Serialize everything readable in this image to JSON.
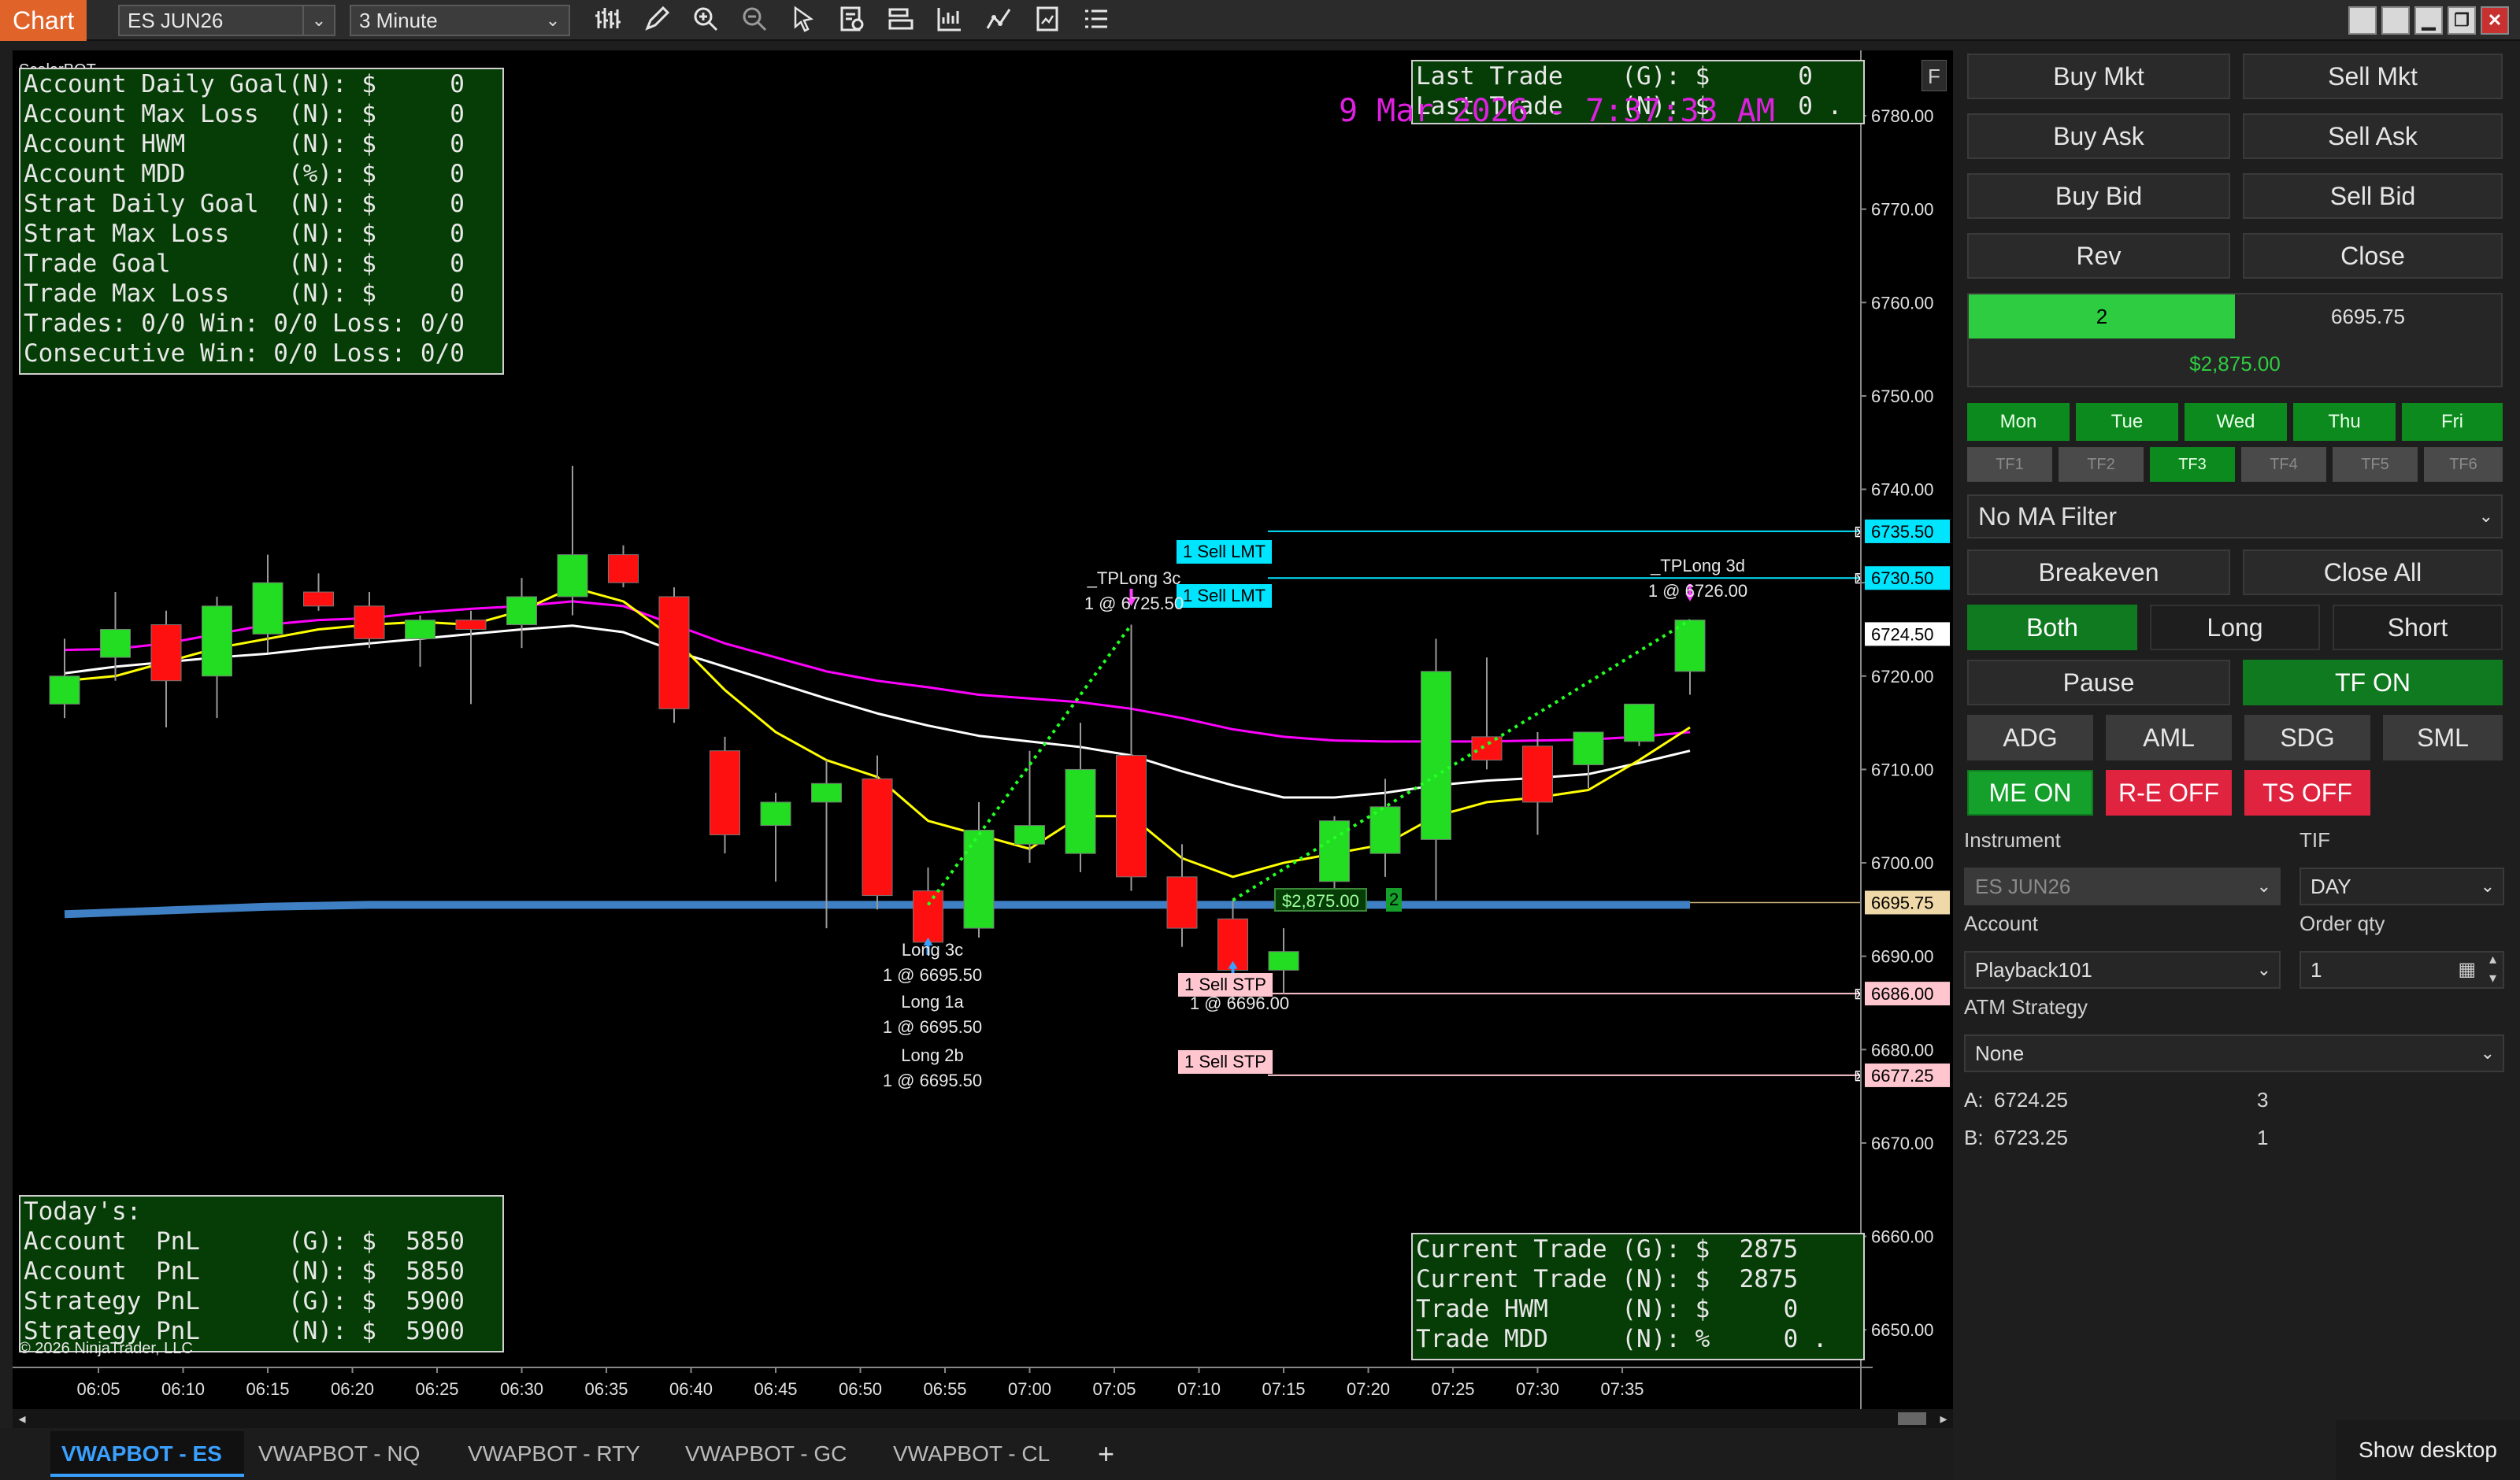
{
  "toolbar": {
    "title": "Chart",
    "instrument": "ES JUN26",
    "interval": "3 Minute",
    "icons": [
      "bar-type-icon",
      "draw-pencil-icon",
      "zoom-in-icon",
      "zoom-out-icon",
      "pointer-icon",
      "data-box-icon",
      "chart-properties-icon",
      "indicators-icon",
      "strategies-icon",
      "templates-icon",
      "list-icon"
    ]
  },
  "window_buttons": {
    "minimize": "▁",
    "restore": "❐",
    "close": "✕"
  },
  "chart": {
    "bot_name": "ScalerBOT",
    "copyright": "© 2026 NinjaTrader, LLC",
    "f_button": "F",
    "clock": "9 Mar 2026 - 7:37:33 AM",
    "top_left_panel": [
      "Account Daily Goal(N): $     0",
      "Account Max Loss  (N): $     0",
      "Account HWM       (N): $     0",
      "Account MDD       (%): $     0",
      "Strat Daily Goal  (N): $     0",
      "Strat Max Loss    (N): $     0",
      "Trade Goal        (N): $     0",
      "Trade Max Loss    (N): $     0",
      "Trades: 0/0 Win: 0/0 Loss: 0/0",
      "Consecutive Win: 0/0 Loss: 0/0"
    ],
    "top_right_panel": [
      "Last Trade    (G): $      0",
      "Last Trade    (N): $      0 ."
    ],
    "bottom_left_panel": [
      "Today's:",
      "Account  PnL      (G): $  5850",
      "Account  PnL      (N): $  5850",
      "Strategy PnL      (G): $  5900",
      "Strategy PnL      (N): $  5900"
    ],
    "bottom_right_panel": [
      "Current Trade (G): $  2875",
      "Current Trade (N): $  2875",
      "Trade HWM     (N): $     0",
      "Trade MDD     (N): %     0 ."
    ],
    "order_tags": {
      "sell_lmt_1": "1 Sell LMT",
      "sell_lmt_2": "1 Sell LMT",
      "sell_stp_1": "1 Sell STP",
      "sell_stp_2": "1 Sell STP",
      "position_pnl": "$2,875.00",
      "position_qty": "2"
    },
    "annotations": {
      "tp_long_3c": "_TPLong 3c",
      "tp_long_3c_price": "1 @ 6725.50",
      "tp_long_3d": "_TPLong 3d",
      "tp_long_3d_price": "1 @ 6726.00",
      "long_3c": "Long 3c",
      "long_3c_price": "1 @ 6695.50",
      "long_1a": "Long 1a",
      "long_1a_price": "1 @ 6695.50",
      "long_2b": "Long 2b",
      "long_2b_price": "1 @ 6695.50",
      "sell_stp_fill": "1 @ 6696.00"
    },
    "y_ticks": [
      "6780.00",
      "6770.00",
      "6760.00",
      "6750.00",
      "6740.00",
      "6730.00",
      "6720.00",
      "6710.00",
      "6700.00",
      "6690.00",
      "6680.00",
      "6670.00",
      "6660.00",
      "6650.00"
    ],
    "price_flags": [
      {
        "label": "6735.50",
        "price": 6735.5,
        "bg": "#00e5ff",
        "fg": "#000000"
      },
      {
        "label": "6730.50",
        "price": 6730.5,
        "bg": "#00e5ff",
        "fg": "#000000"
      },
      {
        "label": "6724.50",
        "price": 6724.5,
        "bg": "#ffffff",
        "fg": "#000000"
      },
      {
        "label": "6695.75",
        "price": 6695.75,
        "bg": "#f0d9a8",
        "fg": "#000000"
      },
      {
        "label": "6686.00",
        "price": 6686.0,
        "bg": "#ffc6cf",
        "fg": "#000000"
      },
      {
        "label": "6677.25",
        "price": 6677.25,
        "bg": "#ffc6cf",
        "fg": "#000000"
      }
    ],
    "x_ticks": [
      "06:05",
      "06:10",
      "06:15",
      "06:20",
      "06:25",
      "06:30",
      "06:35",
      "06:40",
      "06:45",
      "06:50",
      "06:55",
      "07:00",
      "07:05",
      "07:10",
      "07:15",
      "07:20",
      "07:25",
      "07:30",
      "07:35"
    ]
  },
  "chart_data": {
    "type": "candlestick",
    "instrument": "ES JUN26",
    "interval": "3 Minute",
    "xlabel": "",
    "ylabel": "",
    "ylim": [
      6641.5,
      6787.0
    ],
    "candles": [
      {
        "time": "06:03",
        "open": 6717.0,
        "high": 6724.0,
        "low": 6715.5,
        "close": 6720.0
      },
      {
        "time": "06:06",
        "open": 6722.0,
        "high": 6729.0,
        "low": 6719.5,
        "close": 6725.0
      },
      {
        "time": "06:09",
        "open": 6725.5,
        "high": 6727.0,
        "low": 6714.5,
        "close": 6719.5
      },
      {
        "time": "06:12",
        "open": 6720.0,
        "high": 6728.5,
        "low": 6715.5,
        "close": 6727.5
      },
      {
        "time": "06:15",
        "open": 6724.5,
        "high": 6733.0,
        "low": 6722.5,
        "close": 6730.0
      },
      {
        "time": "06:18",
        "open": 6729.0,
        "high": 6731.0,
        "low": 6727.0,
        "close": 6727.5
      },
      {
        "time": "06:21",
        "open": 6727.5,
        "high": 6729.0,
        "low": 6723.0,
        "close": 6724.0
      },
      {
        "time": "06:24",
        "open": 6724.0,
        "high": 6726.5,
        "low": 6721.0,
        "close": 6726.0
      },
      {
        "time": "06:27",
        "open": 6726.0,
        "high": 6727.0,
        "low": 6717.0,
        "close": 6725.0
      },
      {
        "time": "06:30",
        "open": 6725.5,
        "high": 6730.5,
        "low": 6723.0,
        "close": 6728.5
      },
      {
        "time": "06:33",
        "open": 6728.5,
        "high": 6742.5,
        "low": 6726.5,
        "close": 6733.0
      },
      {
        "time": "06:36",
        "open": 6733.0,
        "high": 6734.0,
        "low": 6729.5,
        "close": 6730.0
      },
      {
        "time": "06:39",
        "open": 6728.5,
        "high": 6729.5,
        "low": 6715.0,
        "close": 6716.5
      },
      {
        "time": "06:42",
        "open": 6712.0,
        "high": 6713.5,
        "low": 6701.0,
        "close": 6703.0
      },
      {
        "time": "06:45",
        "open": 6704.0,
        "high": 6707.5,
        "low": 6698.0,
        "close": 6706.5
      },
      {
        "time": "06:48",
        "open": 6706.5,
        "high": 6711.0,
        "low": 6693.0,
        "close": 6708.5
      },
      {
        "time": "06:51",
        "open": 6709.0,
        "high": 6711.5,
        "low": 6695.0,
        "close": 6696.5
      },
      {
        "time": "06:54",
        "open": 6697.0,
        "high": 6699.5,
        "low": 6691.5,
        "close": 6691.5
      },
      {
        "time": "06:57",
        "open": 6693.0,
        "high": 6706.5,
        "low": 6692.0,
        "close": 6703.5
      },
      {
        "time": "07:00",
        "open": 6702.0,
        "high": 6712.0,
        "low": 6700.0,
        "close": 6704.0
      },
      {
        "time": "07:03",
        "open": 6701.0,
        "high": 6715.0,
        "low": 6699.0,
        "close": 6710.0
      },
      {
        "time": "07:06",
        "open": 6711.5,
        "high": 6725.5,
        "low": 6697.0,
        "close": 6698.5
      },
      {
        "time": "07:09",
        "open": 6698.5,
        "high": 6702.0,
        "low": 6691.0,
        "close": 6693.0
      },
      {
        "time": "07:12",
        "open": 6694.0,
        "high": 6696.0,
        "low": 6685.0,
        "close": 6688.5
      },
      {
        "time": "07:15",
        "open": 6688.5,
        "high": 6693.0,
        "low": 6686.0,
        "close": 6690.5
      },
      {
        "time": "07:18",
        "open": 6698.0,
        "high": 6705.0,
        "low": 6696.0,
        "close": 6704.5
      },
      {
        "time": "07:21",
        "open": 6701.0,
        "high": 6709.0,
        "low": 6698.5,
        "close": 6706.0
      },
      {
        "time": "07:24",
        "open": 6702.5,
        "high": 6724.0,
        "low": 6696.0,
        "close": 6720.5
      },
      {
        "time": "07:27",
        "open": 6713.5,
        "high": 6722.0,
        "low": 6710.0,
        "close": 6711.0
      },
      {
        "time": "07:30",
        "open": 6712.5,
        "high": 6714.0,
        "low": 6703.0,
        "close": 6706.5
      },
      {
        "time": "07:33",
        "open": 6710.5,
        "high": 6714.0,
        "low": 6708.0,
        "close": 6714.0
      },
      {
        "time": "07:36",
        "open": 6713.0,
        "high": 6717.0,
        "low": 6712.5,
        "close": 6717.0
      },
      {
        "time": "07:39",
        "open": 6720.5,
        "high": 6726.0,
        "low": 6718.0,
        "close": 6726.0
      }
    ],
    "lines": [
      {
        "color": "#ff00ff",
        "values": [
          6722.8,
          6722.9,
          6723.5,
          6724.5,
          6725.5,
          6726.0,
          6726.2,
          6726.8,
          6727.2,
          6727.5,
          6728.0,
          6727.5,
          6725.5,
          6723.5,
          6722.0,
          6720.5,
          6719.5,
          6718.8,
          6718.0,
          6717.6,
          6717.2,
          6716.5,
          6715.5,
          6714.3,
          6713.5,
          6713.1,
          6713.0,
          6713.0,
          6713.0,
          6713.1,
          6713.2,
          6713.5,
          6714.0
        ]
      },
      {
        "color": "#ffffff",
        "values": [
          6720.3,
          6721.0,
          6721.5,
          6722.0,
          6722.4,
          6723.0,
          6723.5,
          6724.0,
          6724.5,
          6725.0,
          6725.4,
          6724.7,
          6722.7,
          6721.0,
          6719.3,
          6717.6,
          6716.0,
          6714.7,
          6713.6,
          6713.0,
          6712.4,
          6711.5,
          6709.8,
          6708.3,
          6707.0,
          6707.0,
          6707.5,
          6708.3,
          6708.8,
          6709.1,
          6709.5,
          6710.7,
          6712.0
        ]
      },
      {
        "color": "#ffff00",
        "values": [
          6719.5,
          6720.0,
          6721.5,
          6723.0,
          6724.0,
          6725.0,
          6725.5,
          6725.8,
          6725.5,
          6727.0,
          6729.5,
          6728.0,
          6724.0,
          6718.5,
          6714.0,
          6711.0,
          6709.2,
          6704.5,
          6703.0,
          6701.5,
          6705.0,
          6705.0,
          6700.5,
          6698.5,
          6700.0,
          6701.0,
          6702.0,
          6705.0,
          6706.5,
          6707.0,
          6707.8,
          6711.0,
          6714.5
        ]
      },
      {
        "color": "#3f7fc4",
        "values": [
          6694.5,
          6694.7,
          6694.9,
          6695.1,
          6695.3,
          6695.4,
          6695.5,
          6695.5,
          6695.5,
          6695.5,
          6695.5,
          6695.5,
          6695.5,
          6695.5,
          6695.5,
          6695.5,
          6695.5,
          6695.5,
          6695.5,
          6695.5,
          6695.5,
          6695.5,
          6695.5,
          6695.5,
          6695.5,
          6695.5,
          6695.5,
          6695.5,
          6695.5,
          6695.5,
          6695.5,
          6695.5,
          6695.5
        ]
      }
    ],
    "order_levels": [
      {
        "label": "1 Sell LMT",
        "price": 6735.5,
        "color": "#00e5ff"
      },
      {
        "label": "1 Sell LMT",
        "price": 6730.5,
        "color": "#00e5ff"
      },
      {
        "label": "1 Sell STP",
        "price": 6686.0,
        "color": "#ffc6cf"
      },
      {
        "label": "1 Sell STP",
        "price": 6677.25,
        "color": "#ffc6cf"
      }
    ],
    "position": {
      "avg_price": 6695.75,
      "pnl": "$2,875.00",
      "qty": 2
    }
  },
  "right_panel": {
    "buy_mkt": "Buy Mkt",
    "sell_mkt": "Sell Mkt",
    "buy_ask": "Buy Ask",
    "sell_ask": "Sell Ask",
    "buy_bid": "Buy Bid",
    "sell_bid": "Sell Bid",
    "rev": "Rev",
    "close": "Close",
    "position_qty": "2",
    "position_price": "6695.75",
    "position_pnl": "$2,875.00",
    "days": [
      "Mon",
      "Tue",
      "Wed",
      "Thu",
      "Fri"
    ],
    "timeframes": [
      "TF1",
      "TF2",
      "TF3",
      "TF4",
      "TF5",
      "TF6"
    ],
    "ma_filter": "No MA Filter",
    "breakeven": "Breakeven",
    "close_all": "Close All",
    "both": "Both",
    "long": "Long",
    "short": "Short",
    "pause": "Pause",
    "tf_on": "TF ON",
    "adg": "ADG",
    "aml": "AML",
    "sdg": "SDG",
    "sml": "SML",
    "me_on": "ME ON",
    "re_off": "R-E OFF",
    "ts_off": "TS OFF",
    "instrument_label": "Instrument",
    "instrument_value": "ES JUN26",
    "tif_label": "TIF",
    "tif_value": "DAY",
    "account_label": "Account",
    "account_value": "Playback101",
    "order_qty_label": "Order qty",
    "order_qty_value": "1",
    "atm_label": "ATM Strategy",
    "atm_value": "None",
    "ask_label": "A:",
    "ask_price": "6724.25",
    "ask_size": "3",
    "bid_label": "B:",
    "bid_price": "6723.25",
    "bid_size": "1"
  },
  "tabs": [
    "VWAPBOT - ES",
    "VWAPBOT - NQ",
    "VWAPBOT - RTY",
    "VWAPBOT - GC",
    "VWAPBOT - CL"
  ],
  "add_tab": "+",
  "show_desktop": "Show desktop"
}
